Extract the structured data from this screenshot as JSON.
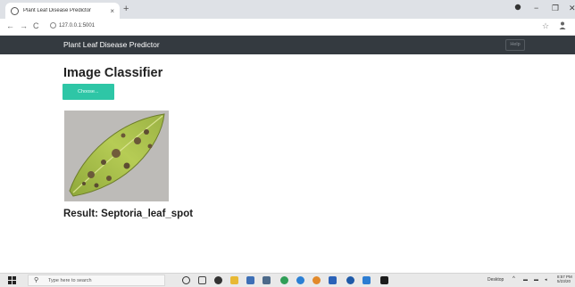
{
  "browser": {
    "tab_title": "Plant Leaf Disease Predictor",
    "tab_close": "×",
    "new_tab": "+",
    "url": "127.0.0.1:5001",
    "nav": {
      "back": "←",
      "forward": "→",
      "reload": "C"
    },
    "window_controls": {
      "minimize": "−",
      "maximize": "❐",
      "close": "✕"
    }
  },
  "navbar": {
    "brand": "Plant Leaf Disease Predictor",
    "help_label": "Help"
  },
  "main": {
    "heading": "Image Classifier",
    "choose_label": "Choose...",
    "result_prefix": "Result: ",
    "result_value": "Septoria_leaf_spot"
  },
  "taskbar": {
    "search_placeholder": "Type here to search",
    "desktop_label": "Desktop",
    "time": "8:57 PM",
    "date": "5/23/20"
  },
  "colors": {
    "navbar_bg": "#343a40",
    "choose_button_bg": "#2ec6a6",
    "leaf_green": "#a9c24a",
    "background": "#ffffff"
  }
}
